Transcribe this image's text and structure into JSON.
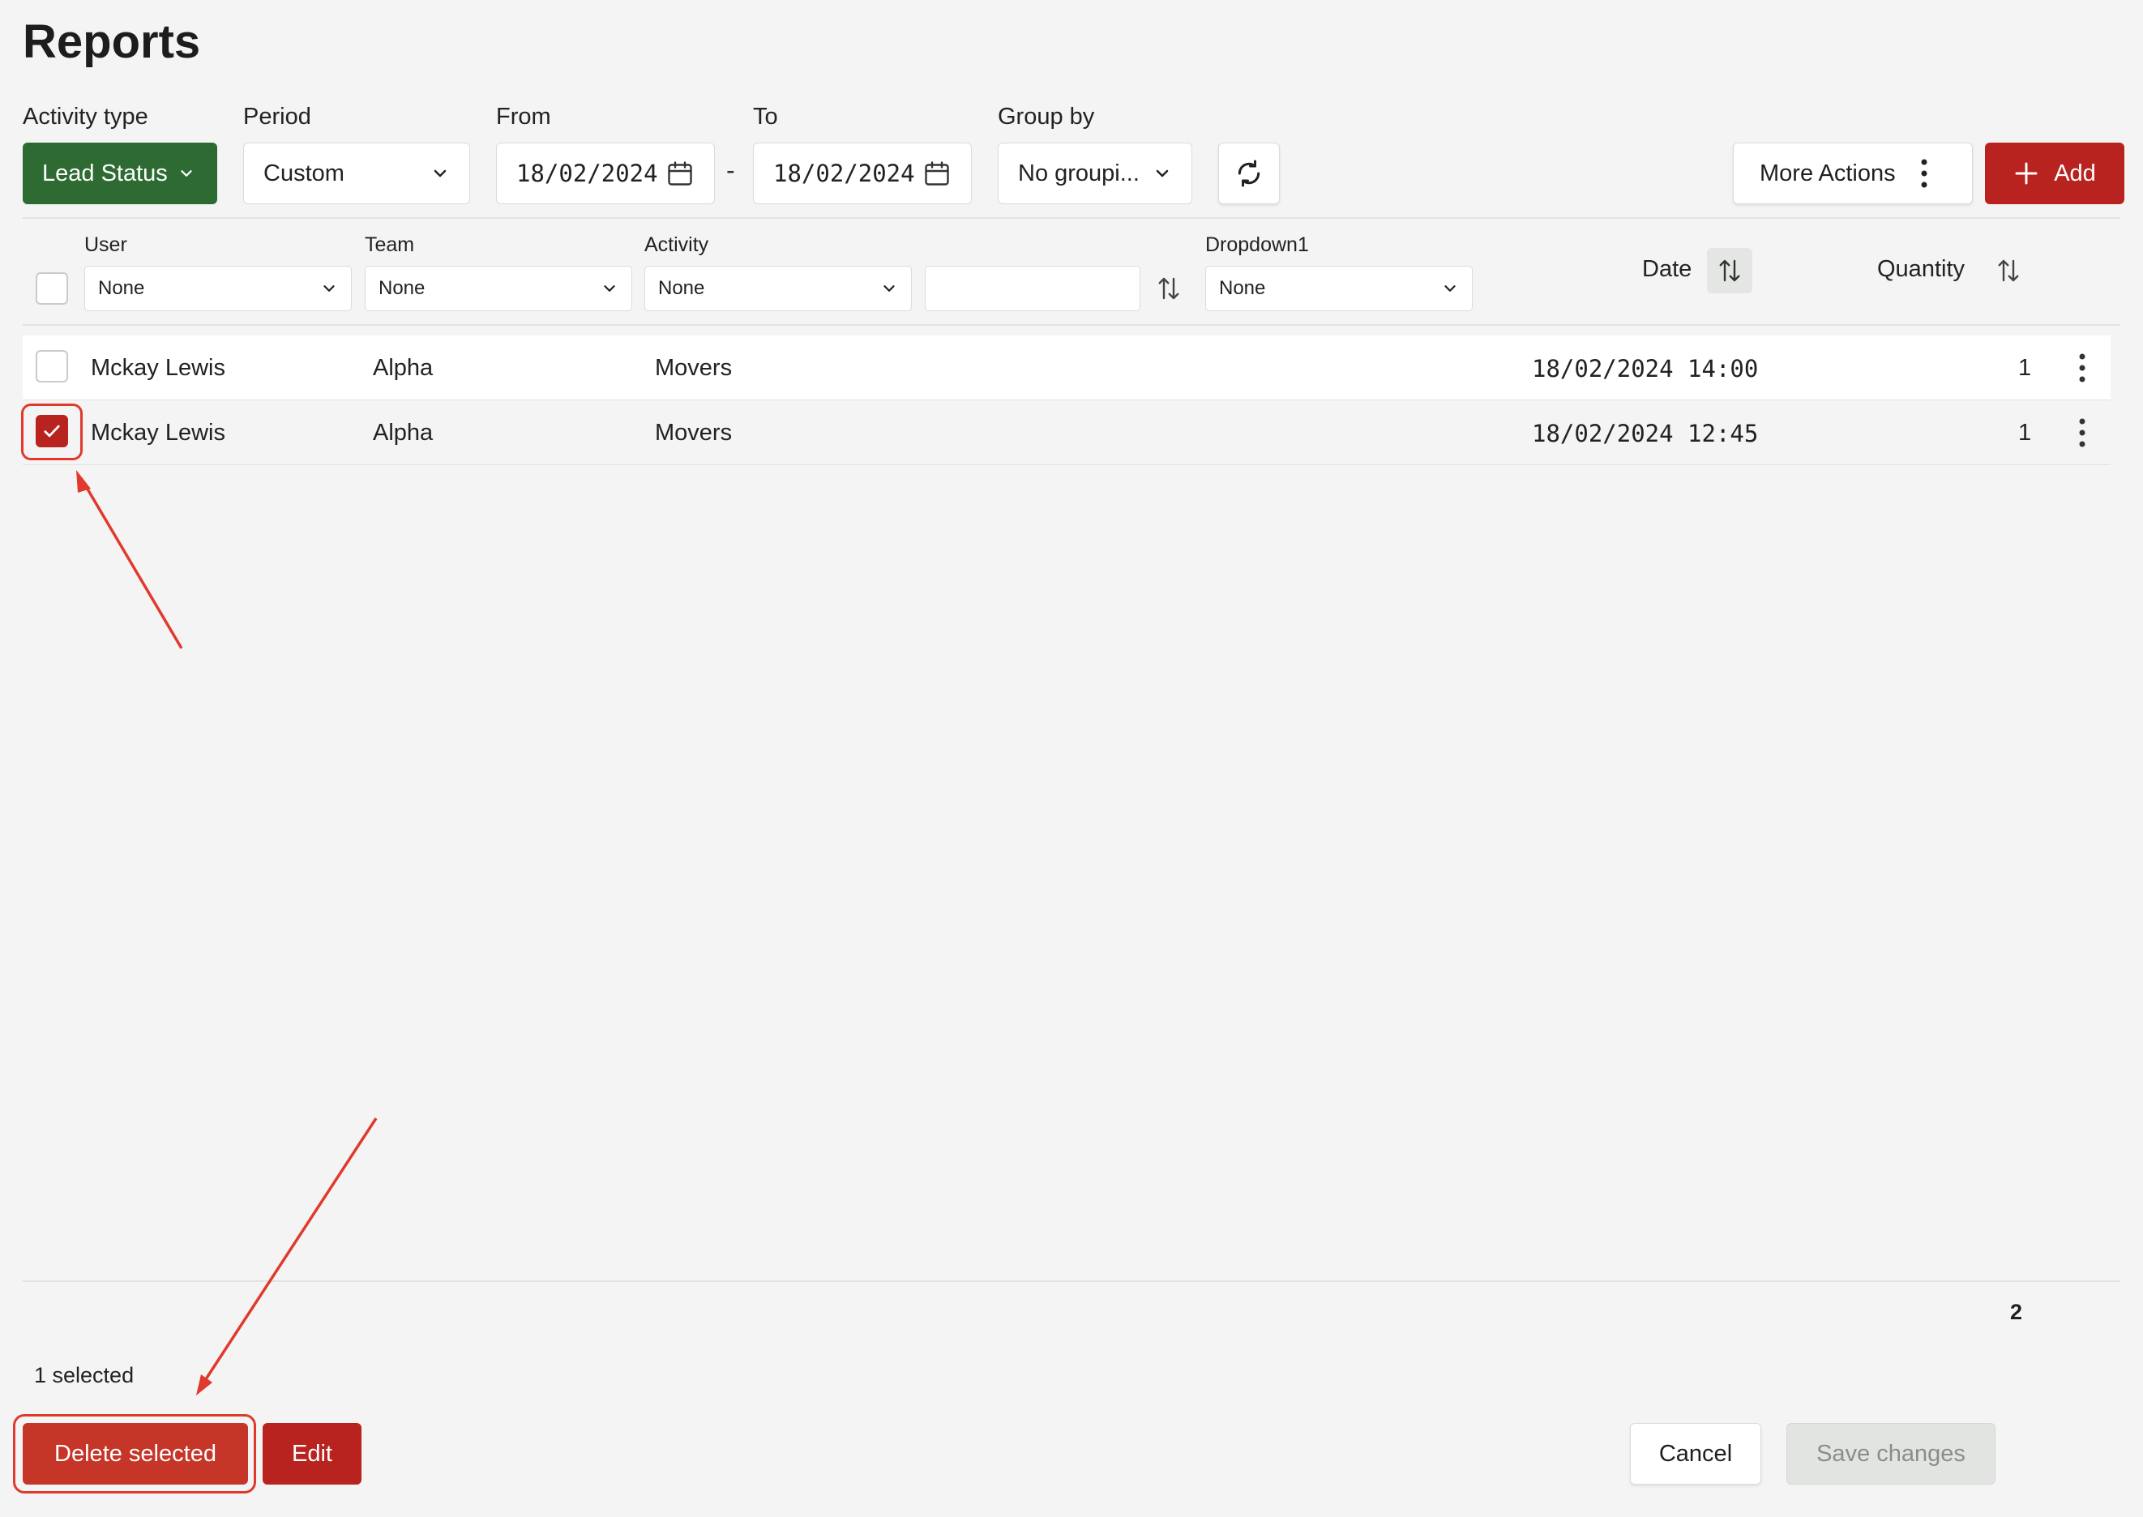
{
  "page": {
    "title": "Reports"
  },
  "filters": {
    "activity_type": {
      "label": "Activity type",
      "value": "Lead Status"
    },
    "period": {
      "label": "Period",
      "value": "Custom"
    },
    "from": {
      "label": "From",
      "value": "18/02/2024"
    },
    "separator": "-",
    "to": {
      "label": "To",
      "value": "18/02/2024"
    },
    "group_by": {
      "label": "Group by",
      "value": "No groupi..."
    }
  },
  "toolbar": {
    "more_actions": "More Actions",
    "add": "Add"
  },
  "table": {
    "header": {
      "user": {
        "label": "User",
        "filter": "None"
      },
      "team": {
        "label": "Team",
        "filter": "None"
      },
      "activity": {
        "label": "Activity",
        "filter": "None"
      },
      "text_filter": "",
      "dropdown1": {
        "label": "Dropdown1",
        "filter": "None"
      },
      "date": "Date",
      "quantity": "Quantity"
    },
    "rows": [
      {
        "user": "Mckay Lewis",
        "team": "Alpha",
        "activity": "Movers",
        "date": "18/02/2024 14:00",
        "quantity": "1",
        "checked": false
      },
      {
        "user": "Mckay Lewis",
        "team": "Alpha",
        "activity": "Movers",
        "date": "18/02/2024 12:45",
        "quantity": "1",
        "checked": true
      }
    ],
    "total_quantity": "2"
  },
  "footer": {
    "selected_count": "1 selected",
    "delete_selected": "Delete selected",
    "edit": "Edit",
    "cancel": "Cancel",
    "save_changes": "Save changes"
  },
  "colors": {
    "primary_red": "#b8231f",
    "green": "#2e6b33",
    "annotation": "#e0392d"
  },
  "icons": [
    "chevron-down-icon",
    "calendar-icon",
    "refresh-icon",
    "kebab-icon",
    "plus-icon",
    "sort-icon",
    "check-icon"
  ]
}
